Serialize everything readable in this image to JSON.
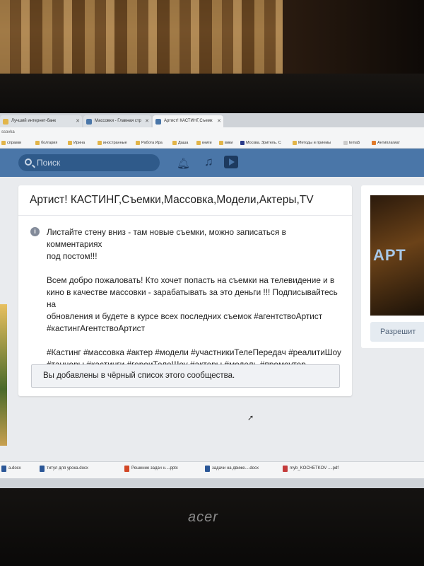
{
  "browser": {
    "tabs": [
      {
        "label": "Лучший интернет-банк",
        "favicon_color": "#e2b54a"
      },
      {
        "label": "Массовки - Главная стр",
        "favicon_color": "#4a76a8"
      },
      {
        "label": "Артист! КАСТИНГ,Съемк",
        "favicon_color": "#4a76a8"
      }
    ],
    "address_fragment": "ssovka",
    "bookmarks": [
      "справки",
      "болгария",
      "Ирина",
      "иностранные",
      "Работа Ира",
      "Даша",
      "книги",
      "вики",
      "Москва. Зритель. С",
      "Методы и приемы",
      "tema5",
      "Антиплагиат"
    ]
  },
  "vk": {
    "search_placeholder": "Поиск",
    "icons": [
      "bell-icon",
      "music-note-icon",
      "video-play-icon"
    ],
    "accent": "#4a76a8"
  },
  "community": {
    "title": "Артист! КАСТИНГ,Съемки,Массовка,Модели,Актеры,TV",
    "description": [
      "Листайте стену вниз - там новые съемки, можно записаться в комментариях\nпод постом!!!",
      "Всем добро пожаловать! Кто хочет попасть на съемки на телевидение и в\nкино в качестве массовки - зарабатывать за это деньги !!! Подписывайтесь на\nобновления и будете в курсе всех последних съемок #агентствоАртист\n#кастингАгентствоАртист",
      "#Кастинг #массовка #актер #модели #участникиТелеПередач #реалитиШоу\n#танцоры #кастинги #героиТелеШоу #актеры #модель #промоутер\n#промоакции"
    ],
    "blacklist_notice": "Вы добавлены в чёрный список этого сообщества.",
    "cover_text": "АРТ",
    "allow_button": "Разрешит"
  },
  "downloads": [
    {
      "name": "a.docx",
      "color": "#2b5797"
    },
    {
      "name": "титул для урока.docx",
      "color": "#2b5797"
    },
    {
      "name": "Решение задач н....pptx",
      "color": "#d24726"
    },
    {
      "name": "задачи на движе....docx",
      "color": "#2b5797"
    },
    {
      "name": "myb_KOCHETKOV ....pdf",
      "color": "#c43b3b"
    }
  ],
  "brand": "acer"
}
